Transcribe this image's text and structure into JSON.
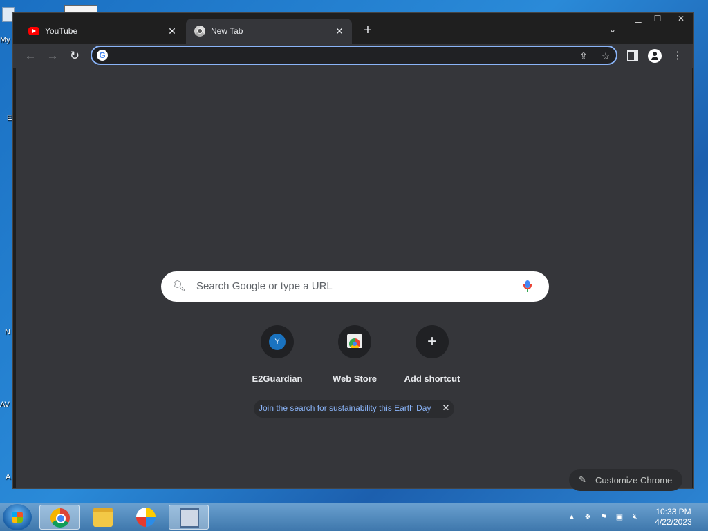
{
  "desktop": {
    "icon_labels": [
      "My",
      "E",
      "N",
      "AV",
      "A"
    ]
  },
  "browser": {
    "tabs": [
      {
        "title": "YouTube",
        "favicon": "youtube-icon",
        "active": false
      },
      {
        "title": "New Tab",
        "favicon": "chrome-icon",
        "active": true
      }
    ],
    "new_tab_symbol": "+",
    "window_controls": [
      "minimize-icon",
      "maximize-icon",
      "close-icon"
    ],
    "omnibox": {
      "value": "",
      "placeholder": ""
    }
  },
  "ntp": {
    "search_placeholder": "Search Google or type a URL",
    "shortcuts": [
      {
        "label": "E2Guardian",
        "icon_letter": "Y"
      },
      {
        "label": "Web Store"
      },
      {
        "label": "Add shortcut"
      }
    ],
    "promo_text": "Join the search for sustainability this Earth Day",
    "customize_label": "Customize Chrome"
  },
  "taskbar": {
    "apps": [
      "chrome-icon",
      "file-explorer-icon",
      "security-shield-icon",
      "network-app-icon"
    ],
    "time": "10:33 PM",
    "date": "4/22/2023"
  },
  "colors": {
    "accent": "#8ab4f8",
    "chrome_dark": "#35363a",
    "titlebar": "#1f1f1f"
  }
}
